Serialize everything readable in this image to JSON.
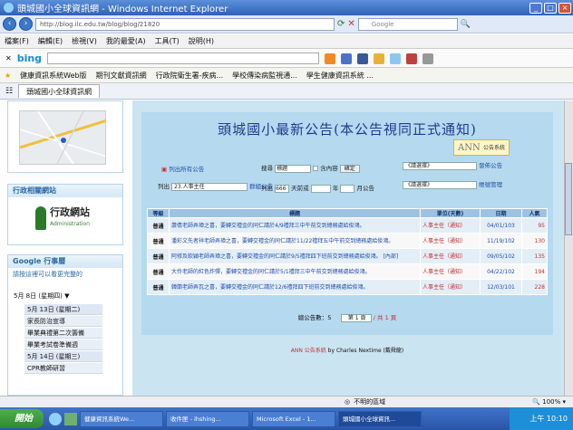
{
  "window": {
    "title": "頭城國小全球資訊網 - Windows Internet Explorer"
  },
  "address": {
    "url": "http://blog.ilc.edu.tw/blog/blog/21820",
    "search_placeholder": "Google"
  },
  "menu": [
    "檔案(F)",
    "編輯(E)",
    "檢視(V)",
    "我的最愛(A)",
    "工具(T)",
    "說明(H)"
  ],
  "bing": {
    "label": "bing"
  },
  "favorites": [
    "健康資訊系統Web版",
    "期刊文獻資訊網",
    "行政院衛生署-疾病...",
    "學校傳染病監視通...",
    "學生健康資訊系統 ..."
  ],
  "tab": {
    "label": "頭城國小全球資訊網"
  },
  "sidebar": {
    "admin_title": "行政相關網站",
    "admin_logo": "行政網站",
    "admin_logo_sub": "Administration",
    "calendar_title": "Google 行事曆",
    "calendar_link": "請按這裡可以看更完整的",
    "date_select": "5月 8日 (星期四)",
    "events": [
      {
        "text": "5月 13日 (星期二)",
        "type": "hd"
      },
      {
        "text": "家長防治宣導",
        "type": "item"
      },
      {
        "text": "畢業典禮第二次籌備",
        "type": "item"
      },
      {
        "text": "畢業考試卷準備週",
        "type": "item"
      },
      {
        "text": "5月 14日 (星期三)",
        "type": "hd"
      },
      {
        "text": "CPR教師研習",
        "type": "item"
      }
    ]
  },
  "board": {
    "title": "頭城國小最新公告(本公告視同正式通知)",
    "ann_button": "公告系統",
    "ann_logo": "ANN",
    "list_all": "列出所有公告",
    "search_label": "搜尋",
    "search_value": "標題",
    "include_label": "含內容",
    "confirm": "確定",
    "select_a": "《請選擇》",
    "post_link": "發佈公告",
    "list_unit_prefix": "列出",
    "unit_value": "23.人事主任",
    "group_link": "群組公告",
    "list_prefix": "列出",
    "days_value": "666",
    "days_label": "天前或",
    "year_label": "年",
    "month_label": "月公告",
    "select_b": "《請選擇》",
    "account_link": "帳號管理"
  },
  "table": {
    "headers": [
      "等級",
      "標題",
      "單位(天數)",
      "日期",
      "人氣"
    ],
    "rows": [
      {
        "cat": "普通",
        "subject": "蕭倩老師弄璋之喜，要轉交禮金的同仁請於4/9禮拜三中午前交到總務處給俊鴻。",
        "unit": "人事主任（通知）",
        "date": "04/01/103",
        "pop": "95"
      },
      {
        "cat": "普通",
        "subject": "潘彩文先者祥老師弄璋之喜，要轉交禮金的同仁請於11/22禮拜五中午前交到總務處給俊鴻。",
        "unit": "人事主任（通知）",
        "date": "11/19/102",
        "pop": "130"
      },
      {
        "cat": "普通",
        "subject": "阿修及欽穎老師弄璋之喜，要轉交禮金的同仁請於9/5禮拜四下班前交到總務處給俊鴻。 [內部]",
        "unit": "人事主任（通知）",
        "date": "09/05/102",
        "pop": "135"
      },
      {
        "cat": "普通",
        "subject": "大伶老師的紅色炸彈，要轉交禮金的同仁請於5/1禮拜三中午前交到總務處給俊鴻。",
        "unit": "人事主任（通知）",
        "date": "04/22/102",
        "pop": "194"
      },
      {
        "cat": "普通",
        "subject": "韓蘭老師弄瓦之喜，要轉交禮金的同仁請於12/6禮拜四下班前交到總務處給俊鴻。",
        "unit": "人事主任（通知）",
        "date": "12/03/101",
        "pop": "228"
      }
    ]
  },
  "pager": {
    "total_label": "總公告數：5",
    "page_value": "第 1 頁",
    "of_label": "/ 共 1 頁"
  },
  "footer": {
    "brand": "ANN 公告系統",
    "credit": "by Charles Nextime (戴舜龍)"
  },
  "statusbar": {
    "zone": "不明的區域",
    "zoom": "100%"
  },
  "taskbar": {
    "start": "開始",
    "items": [
      "健康資訊系統We...",
      "收件匣 - ihshing...",
      "Microsoft Excel - 1...",
      "頭城國小全球資訊..."
    ],
    "time": "上午 10:10"
  }
}
